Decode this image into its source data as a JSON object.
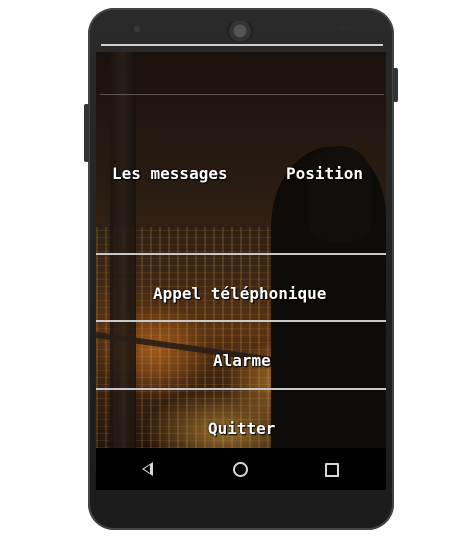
{
  "menu": {
    "messages": "Les messages",
    "position": "Position",
    "appel": "Appel téléphonique",
    "alarme": "Alarme",
    "quitter": "Quitter"
  },
  "navbar": {
    "back_icon": "back-triangle-icon",
    "home_icon": "home-circle-icon",
    "recents_icon": "recents-square-icon"
  }
}
